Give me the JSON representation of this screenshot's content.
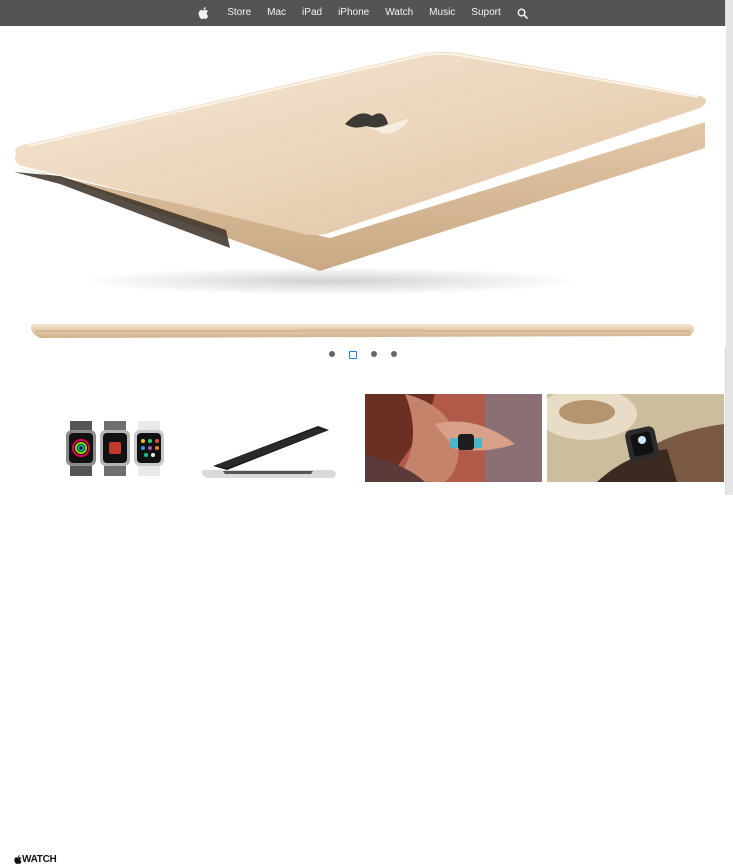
{
  "nav": {
    "logo_icon": "apple-logo-icon",
    "items": [
      "Store",
      "Mac",
      "iPad",
      "iPhone",
      "Watch",
      "Music",
      "Suport"
    ],
    "search_icon": "search-icon"
  },
  "hero": {
    "slides": 4,
    "active_slide": 2
  },
  "promo": {
    "watch_brand": "WATCH"
  },
  "colors": {
    "nav_bg": "#545454",
    "nav_text": "#f2f2f2",
    "laptop_gold": "#e8d3b8",
    "active_dot": "#1e7fd6"
  }
}
